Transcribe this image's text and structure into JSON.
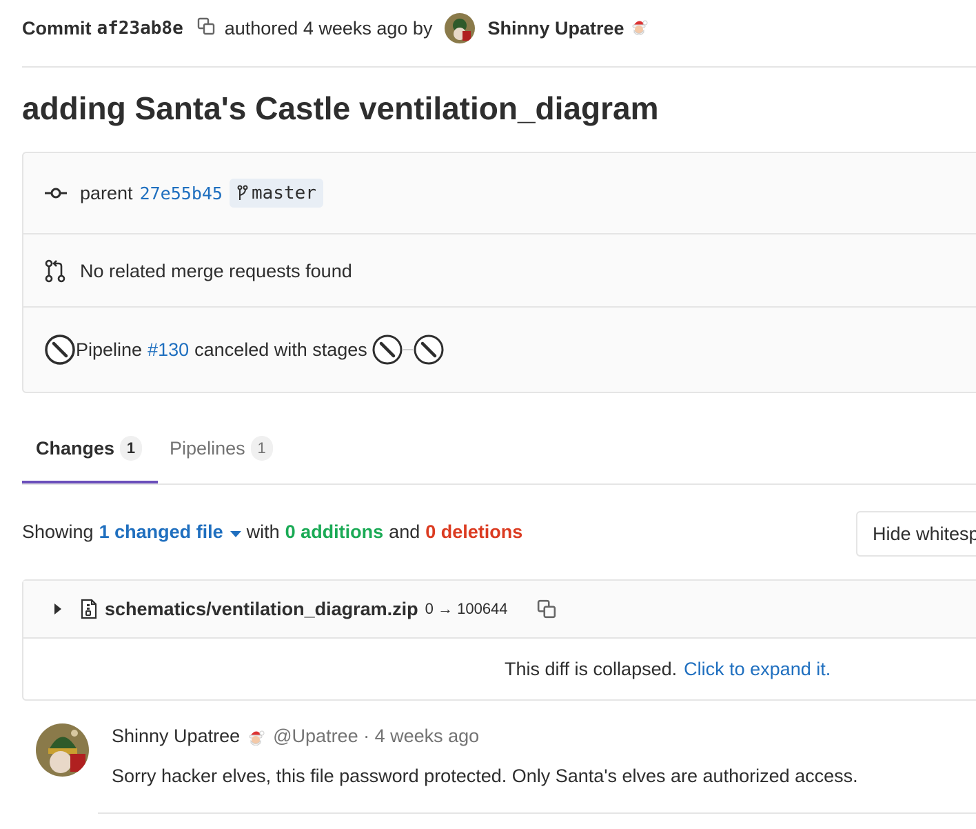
{
  "commit": {
    "label": "Commit",
    "sha": "af23ab8e",
    "authored_text": "authored 4 weeks ago by",
    "author": "Shinny Upatree"
  },
  "title": "adding Santa's Castle ventilation_diagram",
  "info": {
    "parent_label": "parent",
    "parent_sha": "27e55b45",
    "branch": "master",
    "merge_requests": "No related merge requests found",
    "pipeline_prefix": "Pipeline",
    "pipeline_id": "#130",
    "pipeline_suffix": "canceled with stages"
  },
  "tabs": [
    {
      "label": "Changes",
      "count": "1",
      "active": true
    },
    {
      "label": "Pipelines",
      "count": "1",
      "active": false
    }
  ],
  "summary": {
    "showing": "Showing",
    "changed_files": "1 changed file",
    "with": "with",
    "additions": "0 additions",
    "and": "and",
    "deletions": "0 deletions",
    "hide_whitespace": "Hide whitespace changes"
  },
  "file": {
    "path": "schematics/ventilation_diagram.zip",
    "mode": "0 → 100644",
    "collapsed_text": "This diff is collapsed.",
    "expand_link": "Click to expand it."
  },
  "note": {
    "author": "Shinny Upatree",
    "meta": "@Upatree · 4 weeks ago",
    "body": "Sorry hacker elves, this file password protected. Only Santa's elves are authorized access."
  },
  "colors": {
    "link": "#1f6fbf",
    "additions": "#1aaa55",
    "deletions": "#db3b21",
    "tab_active_underline": "#6b4fbb"
  }
}
